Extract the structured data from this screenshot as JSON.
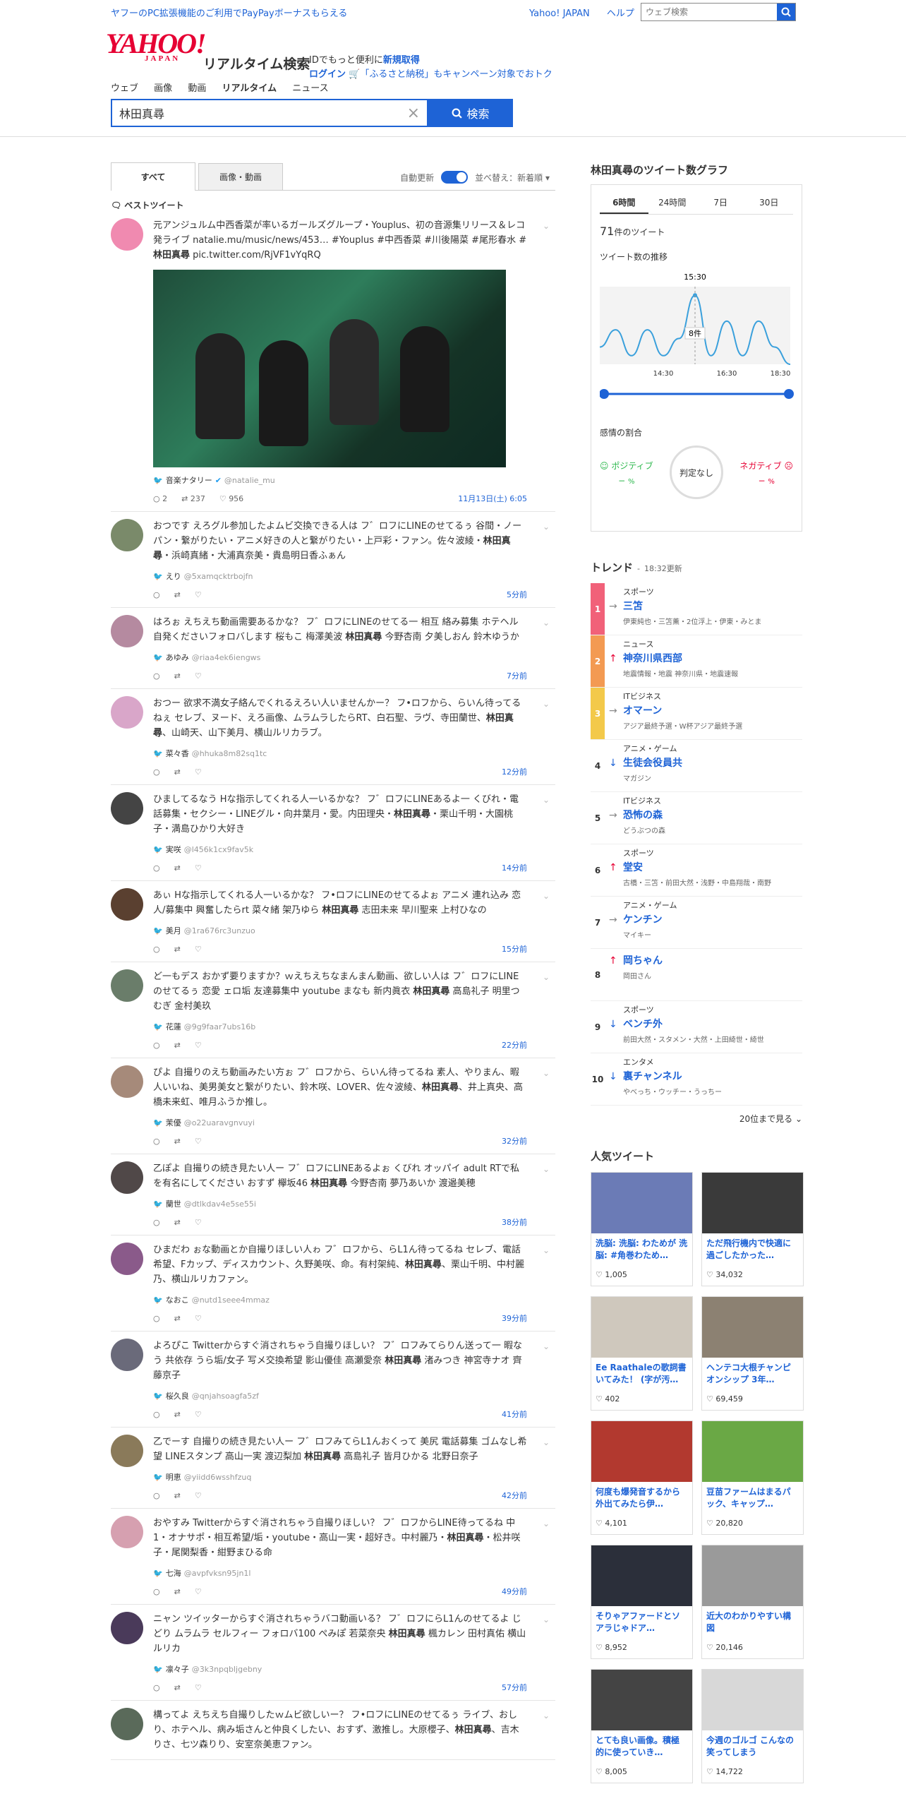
{
  "topbar": {
    "promo": "ヤフーのPC拡張機能のご利用でPayPayボーナスもらえる",
    "links": [
      "Yahoo! JAPAN",
      "ヘルプ"
    ],
    "search_placeholder": "ウェブ検索"
  },
  "header": {
    "logo": "YAHOO!",
    "logo_sub": "JAPAN",
    "service": "リアルタイム検索",
    "id_line1": "IDでもっと便利に",
    "id_signup": "新規取得",
    "id_login": "ログイン",
    "id_campaign": "「ふるさと納税」もキャンペーン対象でおトク"
  },
  "nav": [
    "ウェブ",
    "画像",
    "動画",
    "リアルタイム",
    "ニュース"
  ],
  "search": {
    "query": "林田真尋",
    "button": "検索"
  },
  "tabs": {
    "all": "すべて",
    "media": "画像・動画",
    "auto_update": "自動更新",
    "sort": "並べ替え：新着順"
  },
  "best_label": "ベストツイート",
  "tweets": [
    {
      "text": "元アンジュルム中西香菜が率いるガールズグループ・Youplus、初の音源集リリース＆レコ発ライブ natalie.mu/music/news/453… #Youplus #中西香菜 #川後陽菜 #尾形春水 #林田真尋 pic.twitter.com/RjVF1vYqRQ",
      "name": "音楽ナタリー",
      "handle": "@natalie_mu",
      "replies": "2",
      "rts": "237",
      "likes": "956",
      "time": "11月13日(土) 6:05"
    },
    {
      "text": "おつです えろグル参加したよムビ交換できる人は フ゛ロフにLINEのせてるぅ 谷間・ノーパン・繋がりたい・アニメ好きの人と繋がりたい・上戸彩・ファン。佐々波綾・林田真尋・浜崎真緒・大浦真奈美・貴島明日香ふぁん",
      "name": "えり",
      "handle": "@5xamqcktrbojfn",
      "time": "5分前"
    },
    {
      "text": "はろぉ えちえち動画需要あるかな？ フ゛ロフにLINEのせてる一 相互 絡み募集 ホテヘル 自発くださいフォロバします 桜もこ 梅澤美波 林田真尋 今野杏南 夕美しおん 鈴木ゆうか",
      "name": "あゆみ",
      "handle": "@riaa4ek6iengws",
      "time": "7分前"
    },
    {
      "text": "おつー 欲求不満女子絡んでくれるえろい人いませんかー？ フ•ロフから、らいん待ってるねぇ セレブ、ヌード、えろ画像、ムラムラしたらRT、白石聖、ラヴ、寺田蘭世、林田真尋、山崎天、山下美月、横山ルリカラブ。",
      "name": "菜々香",
      "handle": "@hhuka8m82sq1tc",
      "time": "12分前"
    },
    {
      "text": "ひましてるなう Hな指示してくれる人一いるかな？ フ゛ロフにLINEあるよ一 くびれ・電話募集・セクシー・LINEグル・向井葉月・愛。内田理央・林田真尋・栗山千明・大園桃子・満島ひかり大好き",
      "name": "実咲",
      "handle": "@l456k1cx9fav5k",
      "time": "14分前"
    },
    {
      "text": "あぃ Hな指示してくれる人一いるかな？ フ•ロフにLINEのせてるよぉ アニメ 連れ込み 恋人/募集中 興奮したらrt 菜々緒 架乃ゆら 林田真尋 志田未来 早川聖来 上村ひなの",
      "name": "美月",
      "handle": "@1ra676rc3unzuo",
      "time": "15分前"
    },
    {
      "text": "ど一もデス おかず要りますか？ｗえちえちなまんまん動画、欲しい人は フ゛ロフにLINEのせてるぅ 恋愛 ェロ垢 友達募集中 youtube まなも 新内眞衣 林田真尋 高島礼子 明里つむぎ 金村美玖",
      "name": "花蓮",
      "handle": "@9g9faar7ubs16b",
      "time": "22分前"
    },
    {
      "text": "ぴよ 自撮りのえち動画みたい方ぉ フ゛ロフから、らいん待ってるね 素人、やりまん、暇人いいね、美男美女と繋がりたい、鈴木咲、LOVER、佐々波綾、林田真尋、井上真央、高橋未来虹、唯月ふうか推し。",
      "name": "茉優",
      "handle": "@o22uaravgnvuyi",
      "time": "32分前"
    },
    {
      "text": "乙ぽよ 自撮りの続き見たい人ー フ゛ロフにLINEあるよぉ くびれ オッパイ adult RTで私を有名にしてください おすず 欅坂46 林田真尋 今野杏南 夢乃あいか 渡邉美穂",
      "name": "蘭世",
      "handle": "@dtlkdav4e5se55i",
      "time": "38分前"
    },
    {
      "text": "ひまだわ ぉな動画とか自撮りほしい人ゎ フ゛ロフから、らL1ん待ってるね セレブ、電話希望、Fカップ、ディスカウント、久野美咲、命。有村架純、林田真尋、栗山千明、中村麗乃、横山ルリカファン。",
      "name": "なおこ",
      "handle": "@nutd1seee4mmaz",
      "time": "39分前"
    },
    {
      "text": "よろぴこ Twitterからすぐ消されちゃう自撮りほしい？ フ゛ロフみてらりん送って一 暇なう 共依存 うら垢/女子 写メ交換希望 影山優佳 高瀬愛奈 林田真尋 渚みつき 神宮寺ナオ 齊藤京子",
      "name": "桜久良",
      "handle": "@qnjahsoagfa5zf",
      "time": "41分前"
    },
    {
      "text": "乙でーす 自撮りの続き見たい人ー フ゛ロフみてらL1んおくって 美尻 電話募集 ゴムなし希望 LINEスタンプ 高山一実 渡辺梨加 林田真尋 高島礼子 皆月ひかる 北野日奈子",
      "name": "明恵",
      "handle": "@yiidd6wsshfzuq",
      "time": "42分前"
    },
    {
      "text": "おやすみ Twitterからすぐ消されちゃう自撮りほしい？ フ゛ロフからLINE待ってるね 中1・オナサポ・相互希望/垢・youtube・高山一実・超好き。中村麗乃・林田真尋・松井咲子・尾関梨香・紺野まひる命",
      "name": "七海",
      "handle": "@avpfvksn95jn1l",
      "time": "49分前"
    },
    {
      "text": "ニャン ツイッターからすぐ消されちゃうバコ動画いる？ フ゛ロフにらL1んのせてるよ じどり ムラムラ セルフィー フォロバ100 ぺみぽ 若菜奈央 林田真尋 楓カレン 田村真佑 横山ルリカ",
      "name": "凛々子",
      "handle": "@3k3npqbljgebny",
      "time": "57分前"
    },
    {
      "text": "構ってよ えちえち自撮りしたｗムビ欲しいー？ フ•ロフにLINEのせてるぅ ライブ、おしり、ホテヘル、病み垢さんと仲良くしたい、おすず、激推し。大原櫻子、林田真尋、吉木りさ、七ツ森りり、安室奈美恵ファン。",
      "name": "",
      "handle": "",
      "time": ""
    }
  ],
  "graph": {
    "title": "林田真尋のツイート数グラフ",
    "ranges": [
      "6時間",
      "24時間",
      "7日",
      "30日"
    ],
    "count": "71",
    "count_unit": "件のツイート",
    "trend_label": "ツイート数の推移",
    "peak_time": "15:30",
    "peak_value": "8件",
    "x_ticks": [
      "14:30",
      "16:30",
      "18:30"
    ],
    "sentiment_label": "感情の割合",
    "positive": "ポジティブ",
    "negative": "ネガティブ",
    "neutral": "判定なし",
    "pos_value": "−",
    "neg_value": "−",
    "pct": "%"
  },
  "chart_data": {
    "type": "line",
    "x": [
      "12:30",
      "13:00",
      "13:30",
      "14:00",
      "14:30",
      "15:00",
      "15:30",
      "16:00",
      "16:30",
      "17:00",
      "17:30",
      "18:00",
      "18:30"
    ],
    "values": [
      2,
      4,
      1,
      4,
      1,
      3,
      8,
      1,
      5,
      1,
      5,
      2,
      0
    ],
    "x_ticks": [
      "14:30",
      "16:30",
      "18:30"
    ],
    "annotation": "15:30 8件"
  },
  "trends": {
    "title": "トレンド",
    "updated": "18:32更新",
    "items": [
      {
        "rank": "1",
        "cat": "スポーツ",
        "word": "三笘",
        "dir": "→",
        "rel": "伊東純也・三笘薫・2位浮上・伊東・みとま"
      },
      {
        "rank": "2",
        "cat": "ニュース",
        "word": "神奈川県西部",
        "dir": "↑",
        "rel": "地震情報・地震 神奈川県・地震速報"
      },
      {
        "rank": "3",
        "cat": "ITビジネス",
        "word": "オマーン",
        "dir": "→",
        "rel": "アジア最終予選・W杯アジア最終予選"
      },
      {
        "rank": "4",
        "cat": "アニメ・ゲーム",
        "word": "生徒会役員共",
        "dir": "↓",
        "rel": "マガジン"
      },
      {
        "rank": "5",
        "cat": "ITビジネス",
        "word": "恐怖の森",
        "dir": "→",
        "rel": "どうぶつの森"
      },
      {
        "rank": "6",
        "cat": "スポーツ",
        "word": "堂安",
        "dir": "↑",
        "rel": "古橋・三笘・前田大然・浅野・中島翔哉・南野"
      },
      {
        "rank": "7",
        "cat": "アニメ・ゲーム",
        "word": "ケンチン",
        "dir": "→",
        "rel": "マイキー"
      },
      {
        "rank": "8",
        "cat": "",
        "word": "岡ちゃん",
        "dir": "↑",
        "rel": "岡田さん"
      },
      {
        "rank": "9",
        "cat": "スポーツ",
        "word": "ベンチ外",
        "dir": "↓",
        "rel": "前田大然・スタメン・大然・上田綺世・綺世"
      },
      {
        "rank": "10",
        "cat": "エンタメ",
        "word": "裏チャンネル",
        "dir": "↓",
        "rel": "やべっち・ウッチー・うっちー"
      }
    ],
    "more": "20位まで見る"
  },
  "popular": {
    "title": "人気ツイート",
    "items": [
      {
        "title": "洗脳: 洗脳: わためが 洗脳: #角巻わため…",
        "likes": "1,005",
        "color": "#6b7bb6"
      },
      {
        "title": "ただ飛行機内で快適に過ごしたかった…",
        "likes": "34,032",
        "color": "#3a3a3a"
      },
      {
        "title": "Ee Raathaleの歌詞書いてみた！ (字が汚…",
        "likes": "402",
        "color": "#cfc8bd"
      },
      {
        "title": "ヘンテコ大根チャンピオンシップ 3年…",
        "likes": "69,459",
        "color": "#8c8172"
      },
      {
        "title": "何度も爆発音するから外出てみたら伊…",
        "likes": "4,101",
        "color": "#b2392f"
      },
      {
        "title": "豆苗ファームはまるパック、キャップ…",
        "likes": "20,820",
        "color": "#6aa845"
      },
      {
        "title": "そりゃアファードとソアラじゃドア…",
        "likes": "8,952",
        "color": "#2b2f3a"
      },
      {
        "title": "近大のわかりやすい構図",
        "likes": "20,146",
        "color": "#9a9a9a"
      },
      {
        "title": "とても良い画像。積極的に使っていき…",
        "likes": "8,005",
        "color": "#444444"
      },
      {
        "title": "今週のゴルゴ こんなの笑ってしまう",
        "likes": "14,722",
        "color": "#d8d8d8"
      }
    ]
  }
}
